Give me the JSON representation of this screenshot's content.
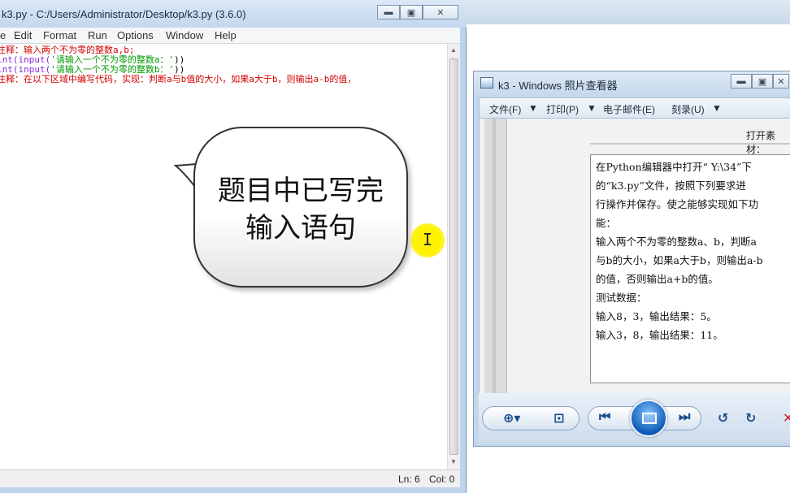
{
  "idle": {
    "title": "k3.py - C:/Users/Administrator/Desktop/k3.py (3.6.0)",
    "menu": [
      "e",
      "Edit",
      "Format",
      "Run",
      "Options",
      "Window",
      "Help"
    ],
    "code": [
      {
        "prefix": "注释：输入两个不为零的整数a,b;",
        "parts": []
      },
      {
        "prefix": "int(input(",
        "str": "'请输入一个不为零的整数a：'",
        "suffix": "))"
      },
      {
        "prefix": "int(input(",
        "str": "'请输入一个不为零的整数b：'",
        "suffix": "))"
      },
      {
        "prefix": "注释：在以下区域中编写代码，实现：判断a与b值的大小，如果a大于b，则输出a-b的值，",
        "parts": []
      }
    ],
    "status_ln": "Ln: 6",
    "status_col": "Col: 0"
  },
  "bubble": {
    "line1": "题目中已写完",
    "line2": "输入语句"
  },
  "viewer": {
    "title": "k3 - Windows 照片查看器",
    "menu": {
      "file": "文件(F)",
      "print": "打印(P)",
      "email": "电子邮件(E)",
      "burn": "刻录(U)"
    },
    "top_text": "打开素材：",
    "lines": [
      "在Python编辑器中打开“ Y:\\34”下",
      "的“k3.py”文件，按照下列要求进",
      "行操作并保存。使之能够实现如下功",
      "能：",
      "输入两个不为零的整数a、b，判断a",
      "与b的大小，如果a大于b，则输出a-b",
      "的值，否则输出a+b的值。",
      "测试数据：",
      "输入8，3，输出结果：5。",
      "输入3，8，输出结果：11。"
    ]
  }
}
